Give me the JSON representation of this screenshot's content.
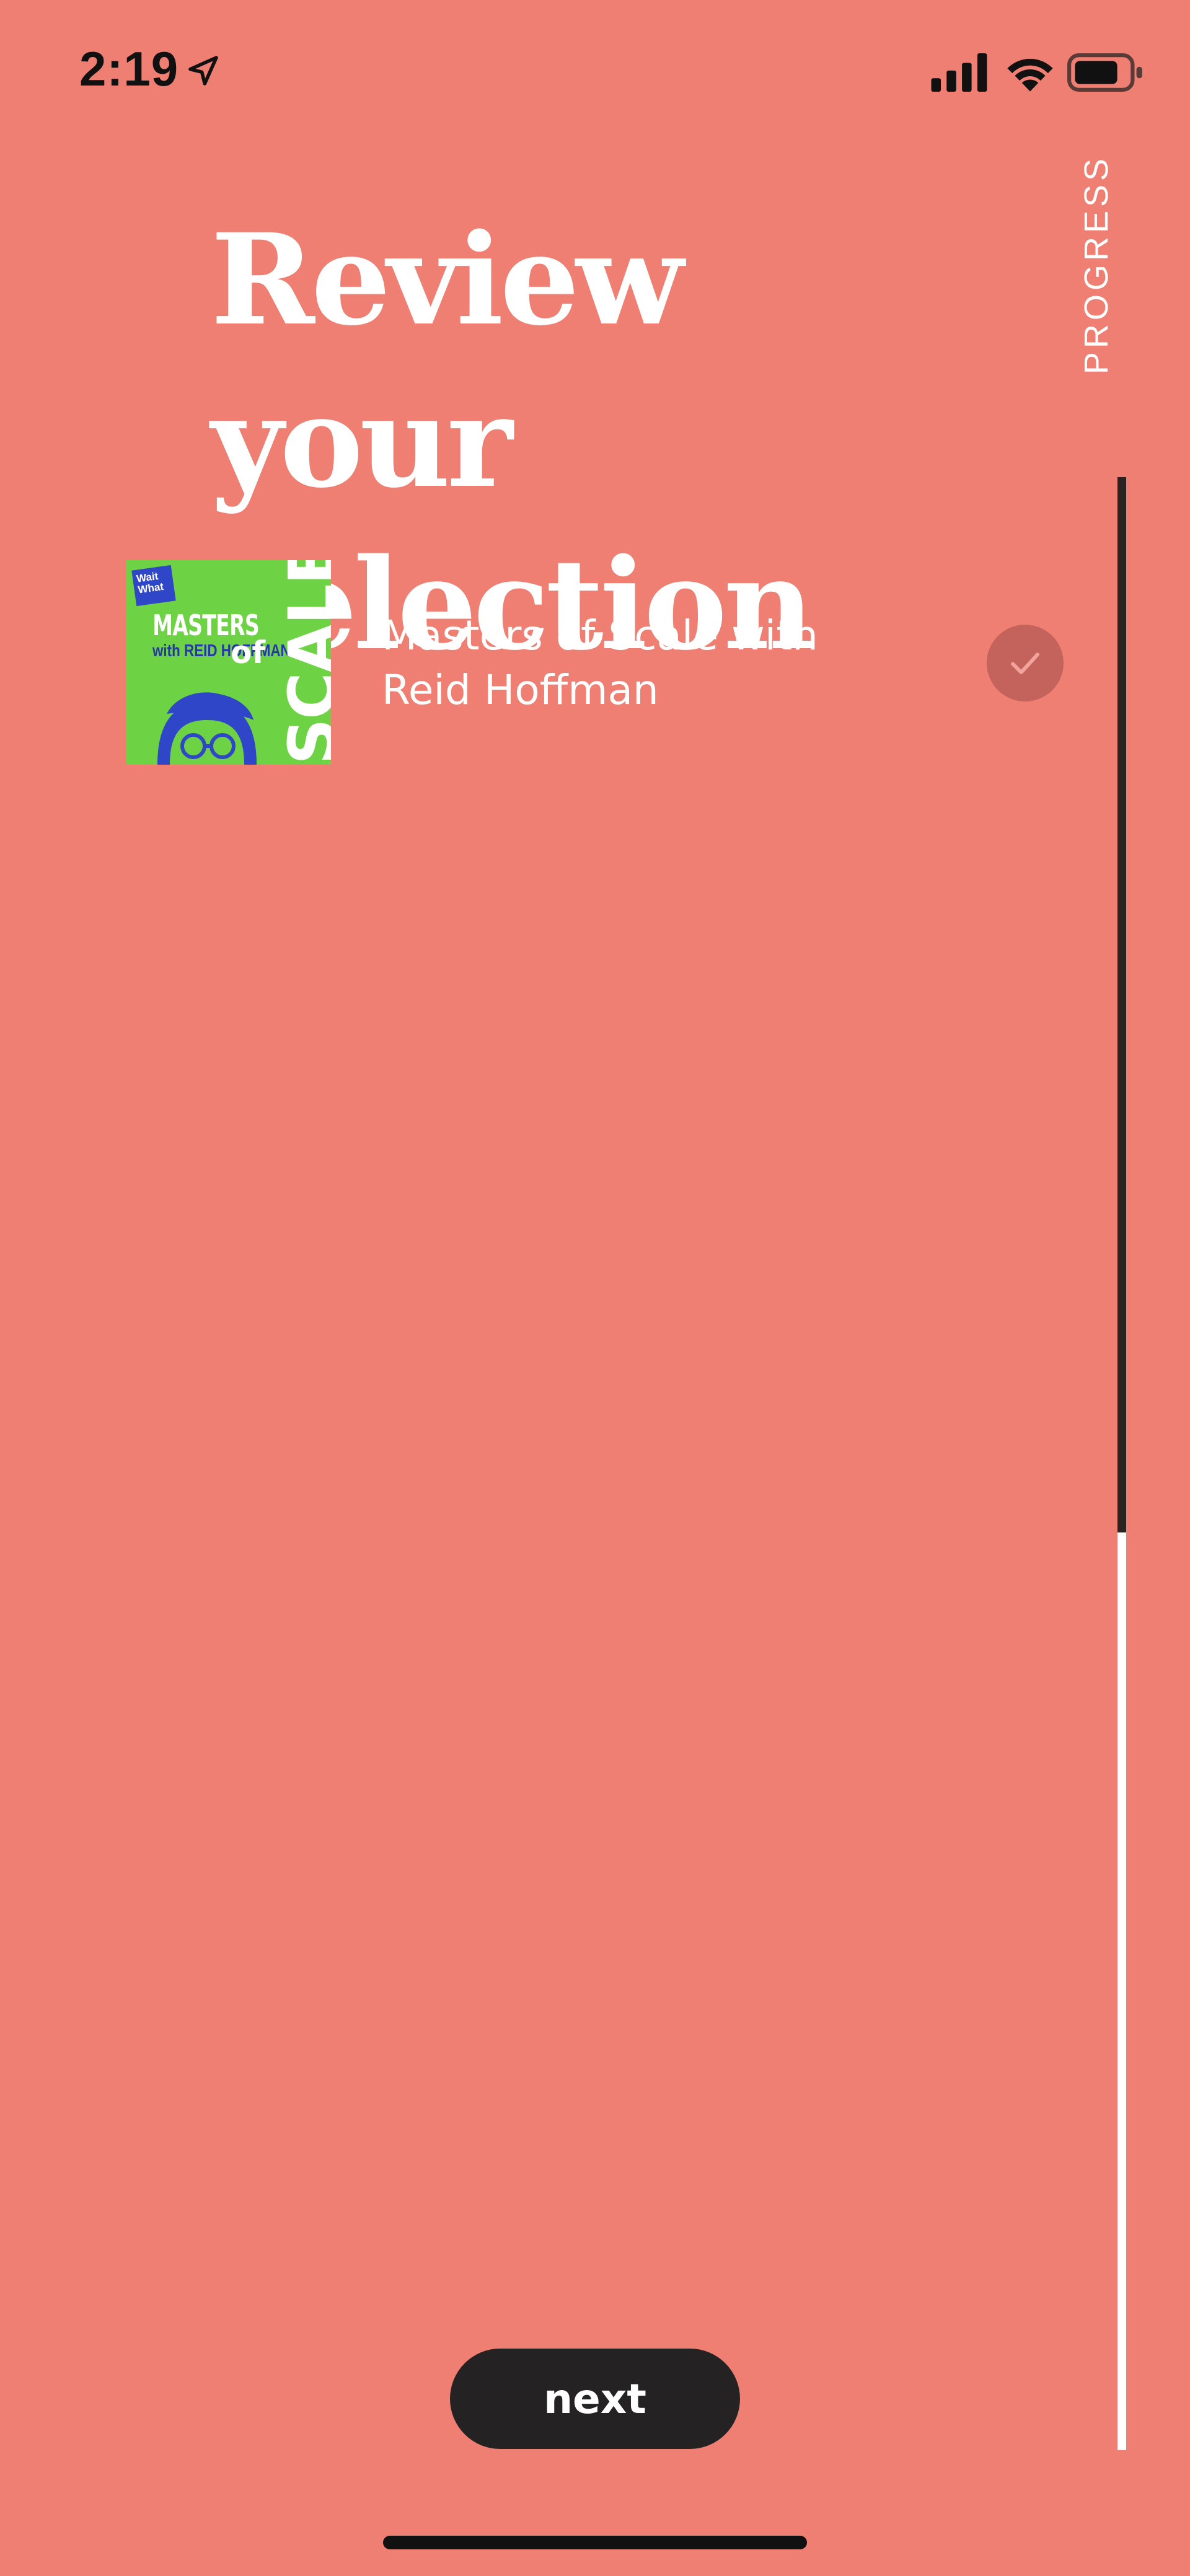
{
  "status_bar": {
    "time": "2:19",
    "icons": [
      "location-arrow-icon",
      "cellular-signal-icon",
      "wifi-icon",
      "battery-icon"
    ]
  },
  "header": {
    "title": "Review your selection"
  },
  "progress": {
    "label": "PROGRESS",
    "value": 0.535,
    "track_color": "#FFFFFF",
    "fill_color": "#2A2322"
  },
  "selection": {
    "items": [
      {
        "title": "Masters of Scale with Reid Hoffman",
        "selected": true,
        "cover": {
          "badge": "Wait What",
          "line1": "MASTERS",
          "line2": "with REID HOFFMAN",
          "line3": "of",
          "line4": "SCALE",
          "icon": "podcast-cover-art"
        }
      }
    ]
  },
  "actions": {
    "next_label": "next"
  },
  "colors": {
    "background": "#EF7F72",
    "check_circle": "#C4635B",
    "button": "#242222"
  }
}
